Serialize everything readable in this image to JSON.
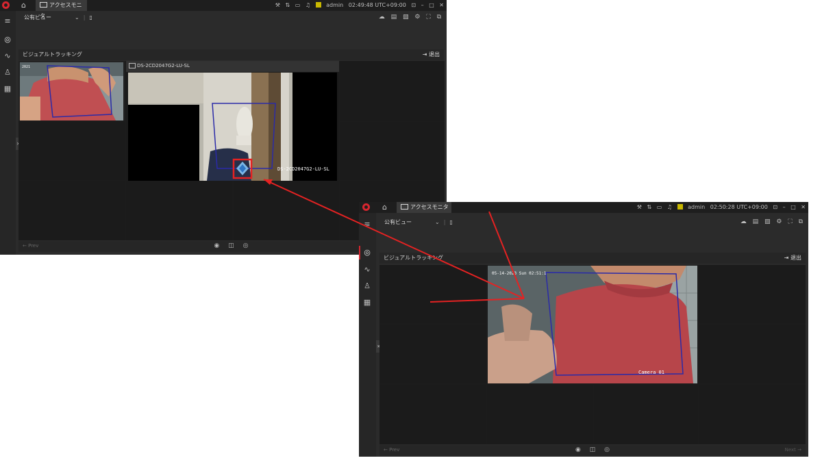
{
  "app": {
    "home_icon": "home-icon",
    "tab_label": "アクセスモニタ",
    "user": "admin"
  },
  "window1": {
    "time": "02:49:48 UTC+09:00",
    "view_name": "公有ビュー",
    "section_title": "ビジュアルトラッキング",
    "exit_label": "退出",
    "camera_tab_title": "DS-2CD2047G2-LU-SL",
    "osd_label": "DS-2CD2047G2-LU-SL",
    "thumb_osd": "2021",
    "prev_label": "Prev"
  },
  "window2": {
    "time": "02:50:28 UTC+09:00",
    "view_name": "公有ビュー",
    "section_title": "ビジュアルトラッキング",
    "exit_label": "退出",
    "osd_label": "Camera 01",
    "osd_top": "05-14-2023 Sun 02:51:1",
    "prev_label": "Prev",
    "next_label": "Next"
  },
  "colors": {
    "brand": "#d7262f",
    "annotation_arrow": "#e52222",
    "tracking_box": "#2a2aa8",
    "bg": "#2b2b2b"
  }
}
